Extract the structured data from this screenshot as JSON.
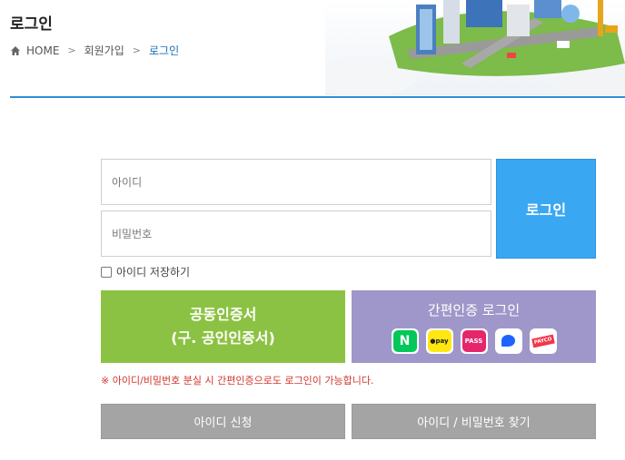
{
  "header": {
    "title": "로그인",
    "breadcrumb": {
      "home": "HOME",
      "level1": "회원가입",
      "current": "로그인"
    }
  },
  "form": {
    "id_placeholder": "아이디",
    "pw_placeholder": "비밀번호",
    "login_label": "로그인",
    "save_id_label": "아이디 저장하기"
  },
  "cert": {
    "line1": "공동인증서",
    "line2": "(구. 공인인증서)"
  },
  "easy_auth": {
    "title": "간편인증 로그인",
    "icons": [
      {
        "name": "naver-icon",
        "text": "N"
      },
      {
        "name": "kakaopay-icon",
        "text": "●pay"
      },
      {
        "name": "pass-icon",
        "text": "PASS"
      },
      {
        "name": "toss-icon",
        "text": ""
      },
      {
        "name": "payco-icon",
        "text": "PAYCO"
      }
    ]
  },
  "notice": "※ 아이디/비밀번호 분실 시 간편인증으로도 로그인이 가능합니다.",
  "buttons": {
    "apply": "아이디 신청",
    "find": "아이디 / 비밀번호 찾기"
  },
  "colors": {
    "accent_blue": "#3aa7f2",
    "cert_green": "#8cc243",
    "easy_purple": "#9f97c9",
    "notice_red": "#d0352b",
    "gray_button": "#a4a4a4"
  }
}
